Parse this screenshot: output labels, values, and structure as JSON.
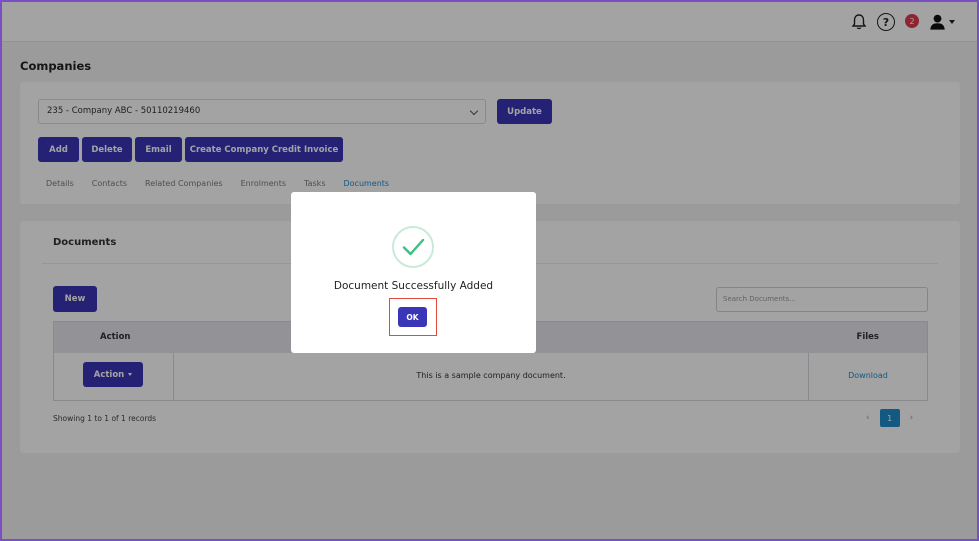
{
  "header": {
    "notification_badge": "2",
    "help_label": "?"
  },
  "page": {
    "title": "Companies"
  },
  "company_select": {
    "value": "235 - Company ABC - 50110219460"
  },
  "toolbar": {
    "update_label": "Update",
    "add_label": "Add",
    "delete_label": "Delete",
    "email_label": "Email",
    "credit_invoice_label": "Create Company Credit Invoice"
  },
  "tabs": [
    {
      "label": "Details"
    },
    {
      "label": "Contacts"
    },
    {
      "label": "Related Companies"
    },
    {
      "label": "Enrolments"
    },
    {
      "label": "Tasks"
    },
    {
      "label": "Documents"
    }
  ],
  "active_tab": "Documents",
  "documents": {
    "title": "Documents",
    "new_label": "New",
    "search_placeholder": "Search Documents...",
    "columns": {
      "action": "Action",
      "files": "Files"
    },
    "rows": [
      {
        "action_label": "Action",
        "description": "This is a sample company document.",
        "file_link": "Download"
      }
    ],
    "showing": "Showing 1 to 1 of 1 records",
    "pager": {
      "current_page": "1",
      "prev": "‹",
      "next": "›"
    }
  },
  "modal": {
    "message": "Document Successfully Added",
    "ok_label": "OK"
  },
  "colors": {
    "primary": "#3b36b8",
    "link": "#1f8ccc",
    "success": "#3fbf7f",
    "badge": "#e23a4f",
    "highlight": "#e04b3d"
  }
}
